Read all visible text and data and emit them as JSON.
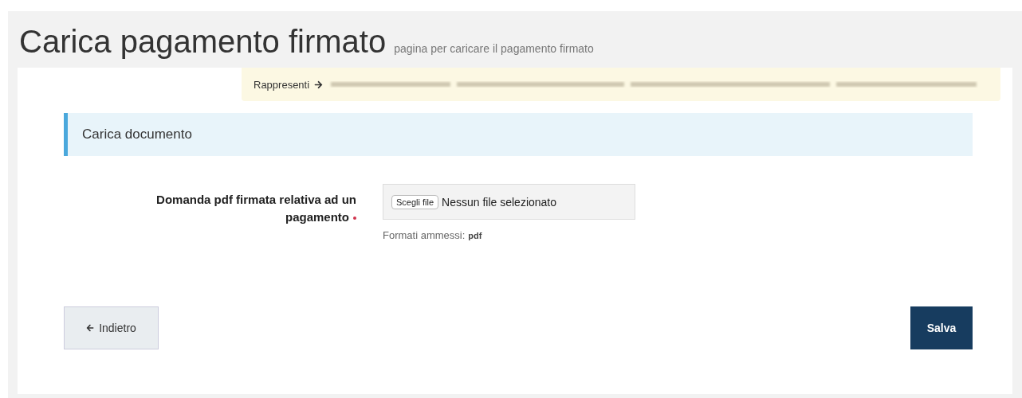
{
  "page": {
    "title": "Carica pagamento firmato",
    "subtitle": "pagina per caricare il pagamento firmato"
  },
  "banner": {
    "label": "Rappresenti",
    "redacted": true
  },
  "section": {
    "title": "Carica documento"
  },
  "fields": [
    {
      "label": "Domanda pdf firmata relativa ad un pagamento",
      "required": true,
      "button": "Scegli file",
      "value": "Nessun file selezionato",
      "help_label": "Formati ammessi:",
      "help_value": "pdf"
    }
  ],
  "buttons": [
    {
      "kind": "back",
      "label": "Indietro"
    },
    {
      "kind": "primary",
      "label": "Salva"
    }
  ]
}
